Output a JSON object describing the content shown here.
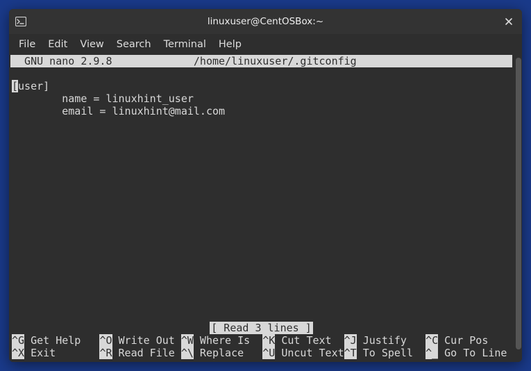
{
  "window": {
    "title": "linuxuser@CentOSBox:~"
  },
  "menubar": {
    "file": "File",
    "edit": "Edit",
    "view": "View",
    "search": "Search",
    "terminal": "Terminal",
    "help": "Help"
  },
  "nano": {
    "app_version": "  GNU nano 2.9.8",
    "header_spacer": "             ",
    "file_path": "/home/linuxuser/.gitconfig",
    "cursor_char": "[",
    "line1_rest": "user]",
    "line2": "        name = linuxhint_user",
    "line3": "        email = linuxhint@mail.com",
    "status": "[ Read 3 lines ]",
    "shortcuts": {
      "r1": {
        "k1": "^G",
        "l1": " Get Help   ",
        "k2": "^O",
        "l2": " Write Out ",
        "k3": "^W",
        "l3": " Where Is  ",
        "k4": "^K",
        "l4": " Cut Text  ",
        "k5": "^J",
        "l5": " Justify   ",
        "k6": "^C",
        "l6": " Cur Pos"
      },
      "r2": {
        "k1": "^X",
        "l1": " Exit       ",
        "k2": "^R",
        "l2": " Read File ",
        "k3": "^\\",
        "l3": " Replace   ",
        "k4": "^U",
        "l4": " Uncut Text",
        "k5": "^T",
        "l5": " To Spell  ",
        "k6": "^_",
        "l6": " Go To Line"
      }
    }
  }
}
